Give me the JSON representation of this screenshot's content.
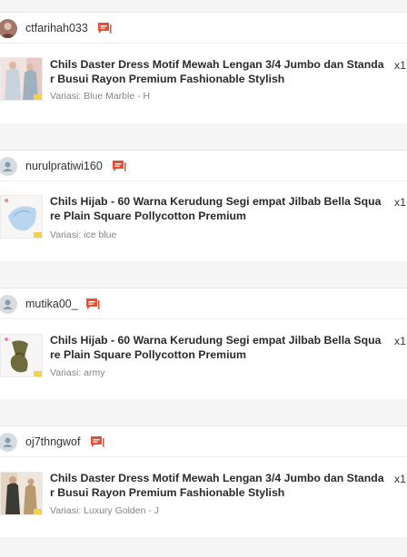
{
  "orders": [
    {
      "username": "ctfarihah033",
      "title": "Chils Daster Dress Motif Mewah Lengan 3/4 Jumbo dan Standar Busui Rayon Premium Fashionable Stylish",
      "quantity": "x1",
      "variant": "Variasi: Blue Marble - H",
      "avatar_type": "photo",
      "thumb_icon": "dress-photo-icon"
    },
    {
      "username": "nurulpratiwi160",
      "title": "Chils Hijab - 60 Warna Kerudung Segi empat Jilbab Bella Square Plain Square Pollycotton Premium",
      "quantity": "x1",
      "variant": "Variasi: ice blue",
      "avatar_type": "default",
      "thumb_icon": "hijab-photo-icon"
    },
    {
      "username": "mutika00_",
      "title": "Chils Hijab - 60 Warna Kerudung Segi empat Jilbab Bella Square Plain Square Pollycotton Premium",
      "quantity": "x1",
      "variant": "Variasi: army",
      "avatar_type": "default",
      "thumb_icon": "hijab-photo-icon"
    },
    {
      "username": "oj7thngwof",
      "title": "Chils Daster Dress Motif Mewah Lengan 3/4 Jumbo dan Standar Busui Rayon Premium Fashionable Stylish",
      "quantity": "x1",
      "variant": "Variasi: Luxury Golden - J",
      "avatar_type": "default",
      "thumb_icon": "dress-photo-icon"
    }
  ],
  "colors": {
    "chat_icon": "#ee4d2d",
    "background": "#f5f5f5",
    "title": "#2a2a2a",
    "variant": "#858585"
  }
}
